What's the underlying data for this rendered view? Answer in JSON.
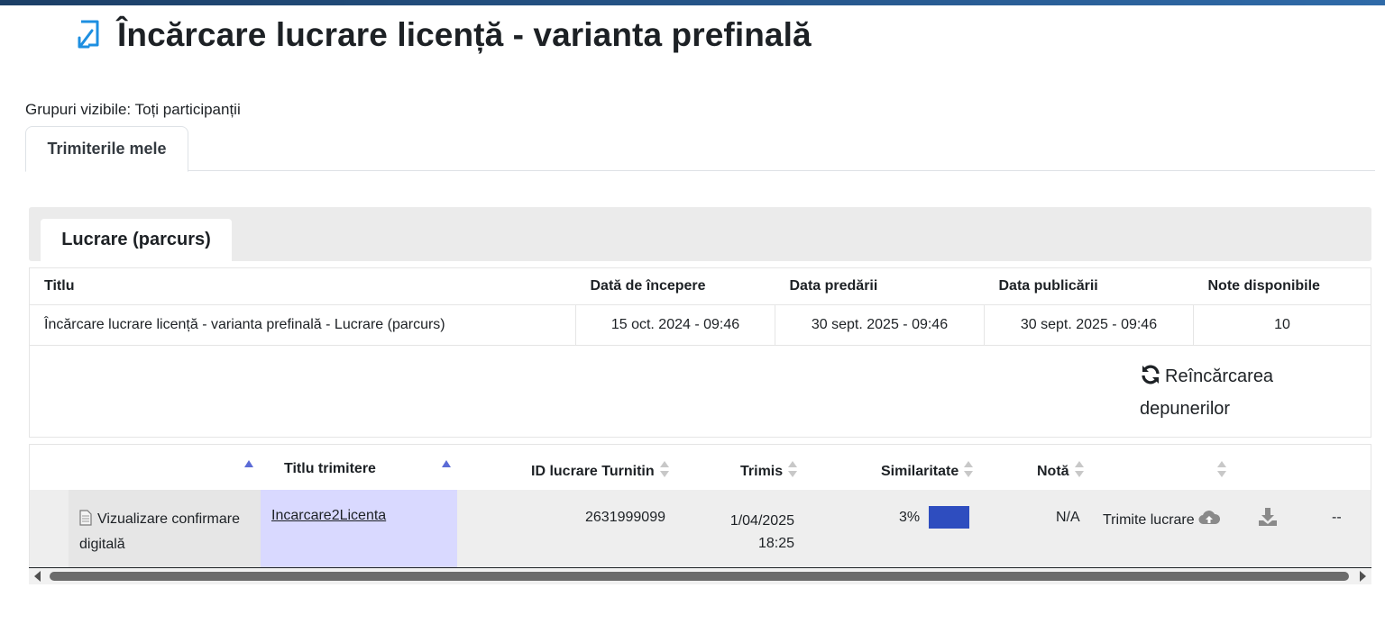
{
  "page": {
    "title": "Încărcare lucrare licență - varianta prefinală",
    "groups_label": "Grupuri vizibile: Toți participanții"
  },
  "tabs": [
    {
      "label": "Trimiterile mele",
      "active": true
    }
  ],
  "part": {
    "tab_label": "Lucrare (parcurs)"
  },
  "info_table": {
    "headers": [
      "Titlu",
      "Dată de începere",
      "Data predării",
      "Data publicării",
      "Note disponibile"
    ],
    "row": [
      "Încărcare lucrare licență - varianta prefinală - Lucrare (parcurs)",
      "15 oct. 2024 - 09:46",
      "30 sept. 2025 - 09:46",
      "30 sept. 2025 - 09:46",
      "10"
    ]
  },
  "refresh": {
    "label": "Reîncărcarea depunerilor",
    "icon": "refresh-icon"
  },
  "submissions": {
    "headers": {
      "title": "Titlu trimitere",
      "paper_id": "ID lucrare Turnitin",
      "sent": "Trimis",
      "similarity": "Similaritate",
      "grade": "Notă"
    },
    "row": {
      "confirmation": "Vizualizare confirmare digitală",
      "title": "Incarcare2Licenta",
      "paper_id": "2631999099",
      "sent_date": "1/04/2025",
      "sent_time": "18:25",
      "similarity": "3%",
      "grade": "N/A",
      "submit_label": "Trimite lucrare",
      "last": "--"
    }
  },
  "colors": {
    "accent": "#2e4dbf",
    "highlight": "#d9d9ff",
    "sort_active": "#5b6bd6",
    "sort_inactive": "#c8c8c8"
  }
}
